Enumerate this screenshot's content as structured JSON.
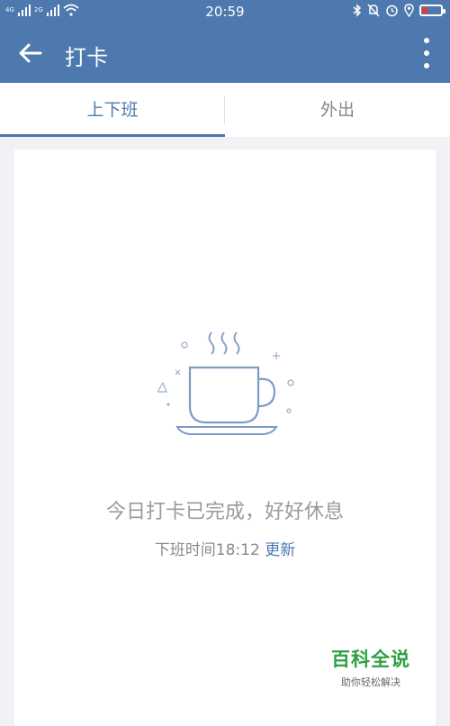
{
  "status_bar": {
    "time": "20:59",
    "net_left": "4G",
    "net_right": "2G",
    "battery_level": 0.25,
    "icons": [
      "signal-icon",
      "wifi-icon",
      "bluetooth-icon",
      "mute-icon",
      "alarm-icon",
      "location-icon",
      "battery-icon"
    ]
  },
  "app_bar": {
    "title": "打卡"
  },
  "tabs": [
    {
      "label": "上下班",
      "active": true
    },
    {
      "label": "外出",
      "active": false
    }
  ],
  "main": {
    "done_message": "今日打卡已完成，好好休息",
    "off_time_label": "下班时间",
    "off_time": "18:12",
    "refresh_label": "更新"
  },
  "watermark": {
    "title": "百科全说",
    "subtitle": "助你轻松解决"
  },
  "colors": {
    "primary": "#4d79ae",
    "background": "#f1f2f5",
    "watermark_green": "#2ea043",
    "battery_red": "#e53935"
  }
}
